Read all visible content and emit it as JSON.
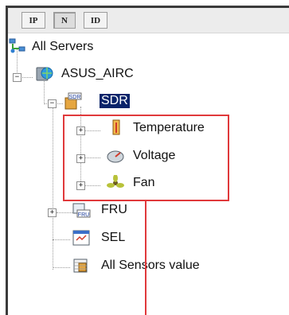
{
  "toolbar": {
    "buttons": [
      {
        "label": "IP"
      },
      {
        "label": "N"
      },
      {
        "label": "ID"
      }
    ]
  },
  "tree": {
    "root": {
      "label": "All Servers",
      "icon": "servers-network-icon"
    },
    "server": {
      "label": "ASUS_AIRC",
      "icon": "server-globe-icon"
    },
    "sdr": {
      "label": "SDR",
      "badge": "SDR",
      "icon": "sdr-icon"
    },
    "sensors": [
      {
        "label": "Temperature",
        "icon": "thermometer-icon"
      },
      {
        "label": "Voltage",
        "icon": "voltage-gauge-icon"
      },
      {
        "label": "Fan",
        "icon": "fan-icon"
      }
    ],
    "fru": {
      "label": "FRU",
      "badge": "FRU",
      "icon": "fru-icon"
    },
    "sel": {
      "label": "SEL",
      "icon": "event-log-icon"
    },
    "all_sensors": {
      "label": "All Sensors value",
      "icon": "sensor-table-icon"
    }
  },
  "colors": {
    "highlight": "#e0393b",
    "selection": "#0a246a"
  }
}
